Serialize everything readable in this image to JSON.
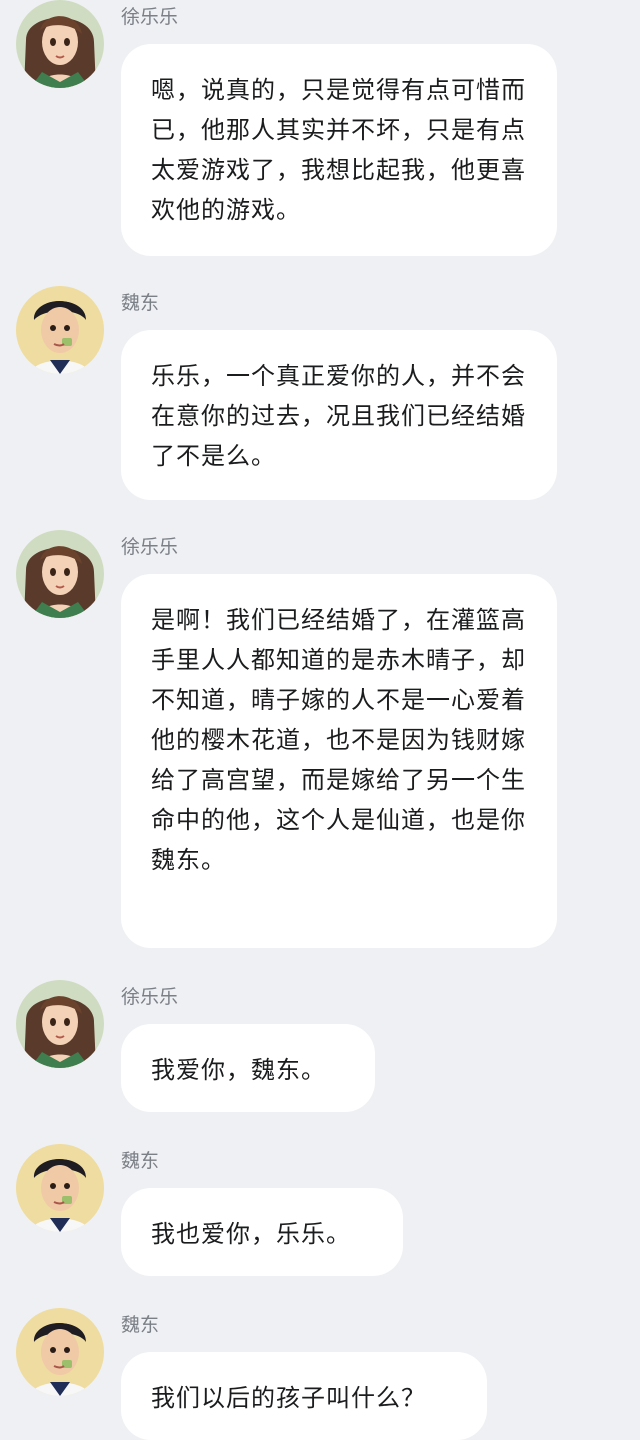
{
  "colors": {
    "background": "#eef0f3",
    "bubble": "#ffffff",
    "name_text": "#7b7f86",
    "message_text": "#1b1c1e"
  },
  "icons": {
    "lele_avatar": "girl-with-brown-hair-avatar-icon",
    "weidong_avatar": "man-with-dark-hair-avatar-icon"
  },
  "messages": [
    {
      "sender": "徐乐乐",
      "avatar": "lele",
      "text": "嗯，说真的，只是觉得有点可惜而已，他那人其实并不坏，只是有点太爱游戏了，我想比起我，他更喜欢他的游戏。"
    },
    {
      "sender": "魏东",
      "avatar": "weidong",
      "text": "乐乐，一个真正爱你的人，并不会在意你的过去，况且我们已经结婚了不是么。"
    },
    {
      "sender": "徐乐乐",
      "avatar": "lele",
      "text": "是啊！我们已经结婚了，在灌篮高手里人人都知道的是赤木晴子，却不知道，晴子嫁的人不是一心爱着他的樱木花道，也不是因为钱财嫁给了高宫望，而是嫁给了另一个生命中的他，这个人是仙道，也是你魏东。"
    },
    {
      "sender": "徐乐乐",
      "avatar": "lele",
      "text": "我爱你，魏东。"
    },
    {
      "sender": "魏东",
      "avatar": "weidong",
      "text": "我也爱你，乐乐。"
    },
    {
      "sender": "魏东",
      "avatar": "weidong",
      "text": "我们以后的孩子叫什么？"
    }
  ]
}
